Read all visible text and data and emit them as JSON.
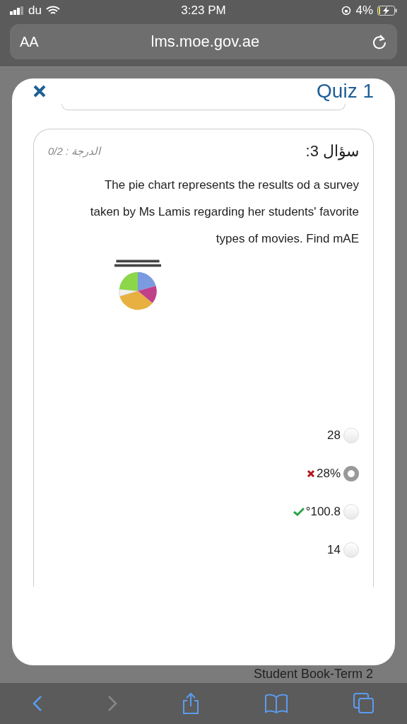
{
  "status_bar": {
    "carrier": "du",
    "time": "3:23 PM",
    "battery": "4%"
  },
  "address_bar": {
    "text_size": "AA",
    "url": "lms.moe.gov.ae"
  },
  "modal": {
    "title": "Quiz 1",
    "question": {
      "number": "سؤال 3:",
      "grade": "الدرجة : 0/2",
      "text": "The pie chart represents the results od a survey taken by Ms Lamis regarding her students' favorite types of movies. Find mAE",
      "options": [
        {
          "label": "28",
          "selected": false,
          "kind": "plain"
        },
        {
          "label": "28%",
          "selected": true,
          "kind": "wrong"
        },
        {
          "label": "°100.8",
          "selected": false,
          "kind": "correct"
        },
        {
          "label": "14",
          "selected": false,
          "kind": "plain"
        }
      ]
    }
  },
  "background_item": "Student Book-Term 2"
}
